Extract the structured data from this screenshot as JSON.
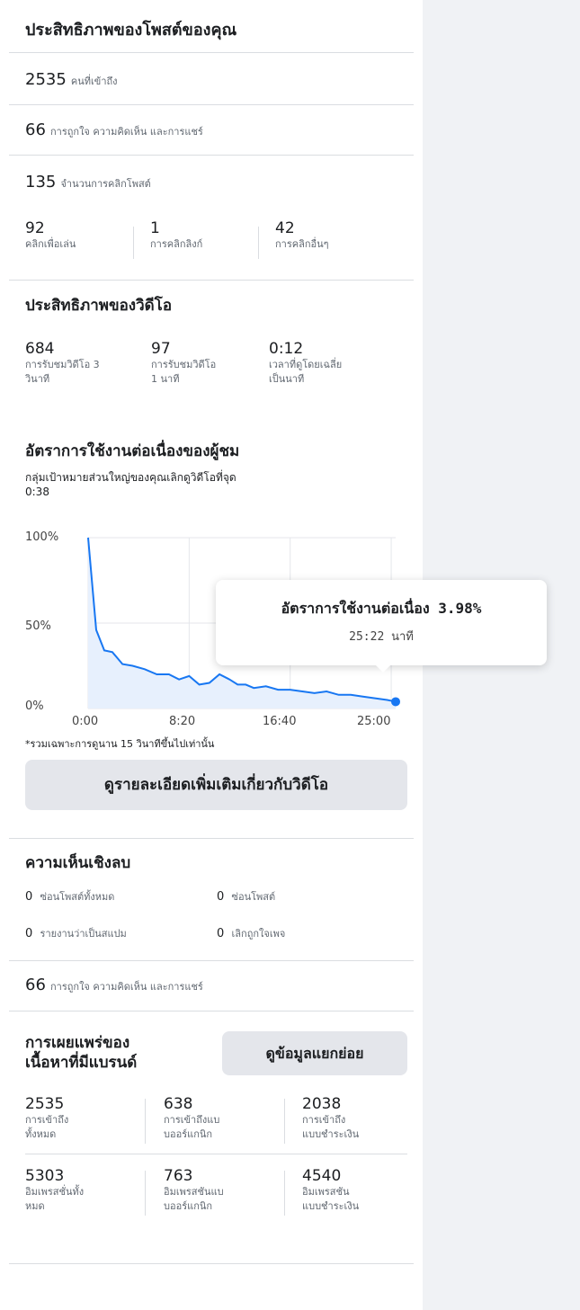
{
  "post_performance": {
    "title": "ประสิทธิภาพของโพสต์ของคุณ",
    "reach": {
      "value": "2535",
      "label": "คนที่เข้าถึง"
    },
    "engagement": {
      "value": "66",
      "label": "การถูกใจ ความคิดเห็น และการแชร์"
    },
    "clicks": {
      "value": "135",
      "label": "จำนวนการคลิกโพสต์"
    },
    "click_breakdown": [
      {
        "value": "92",
        "label": "คลิกเพื่อเล่น"
      },
      {
        "value": "1",
        "label": "การคลิกลิงก์"
      },
      {
        "value": "42",
        "label": "การคลิกอื่นๆ"
      }
    ]
  },
  "video_performance": {
    "title": "ประสิทธิภาพของวิดีโอ",
    "stats": [
      {
        "value": "684",
        "label1": "การรับชมวิดีโอ 3",
        "label2": "วินาที"
      },
      {
        "value": "97",
        "label1": "การรับชมวิดีโอ",
        "label2": "1 นาที"
      },
      {
        "value": "0:12",
        "label1": "เวลาที่ดูโดยเฉลี่ย",
        "label2": "เป็นนาที"
      }
    ],
    "retention_title": "อัตราการใช้งานต่อเนื่องของผู้ชม",
    "retention_subtitle1": "กลุ่มเป้าหมายส่วนใหญ่ของคุณเลิกดูวิดีโอที่จุด",
    "retention_subtitle2": "0:38",
    "footnote": "*รวมเฉพาะการดูนาน 15 วินาทีขึ้นไปเท่านั้น",
    "more_button": "ดูรายละเอียดเพิ่มเติมเกี่ยวกับวิดีโอ",
    "tooltip": {
      "title": "อัตราการใช้งานต่อเนื่อง 3.98%",
      "time": "25:22 นาที"
    }
  },
  "chart_data": {
    "type": "area",
    "x_ticks": [
      "0:00",
      "8:20",
      "16:40",
      "25:00"
    ],
    "y_ticks": [
      "100%",
      "50%",
      "0%"
    ],
    "ylim": [
      0,
      100
    ],
    "xlim_seconds": [
      0,
      1522
    ],
    "grid": true,
    "x_seconds": [
      0,
      40,
      80,
      120,
      170,
      220,
      280,
      340,
      400,
      450,
      500,
      550,
      600,
      650,
      700,
      740,
      780,
      820,
      880,
      940,
      1000,
      1060,
      1120,
      1180,
      1240,
      1300,
      1360,
      1420,
      1480,
      1522
    ],
    "values": [
      100,
      46,
      34,
      33,
      26,
      25,
      23,
      20,
      20,
      17,
      19,
      14,
      15,
      20,
      17,
      14,
      14,
      12,
      13,
      11,
      11,
      10,
      9,
      10,
      8,
      8,
      7,
      6,
      5,
      3.98
    ],
    "highlight_point": {
      "x_seconds": 1522,
      "value": 3.98
    },
    "line_color": "#1877f2",
    "fill_color": "#e7f0fd"
  },
  "negative_feedback": {
    "title": "ความเห็นเชิงลบ",
    "items": [
      {
        "value": "0",
        "label": "ซ่อนโพสต์ทั้งหมด"
      },
      {
        "value": "0",
        "label": "ซ่อนโพสต์"
      },
      {
        "value": "0",
        "label": "รายงานว่าเป็นสแปม"
      },
      {
        "value": "0",
        "label": "เลิกถูกใจเพจ"
      }
    ],
    "engagement": {
      "value": "66",
      "label": "การถูกใจ ความคิดเห็น และการแชร์"
    }
  },
  "branded_content": {
    "title1": "การเผยแพร่ของ",
    "title2": "เนื้อหาที่มีแบรนด์",
    "breakdown_button": "ดูข้อมูลแยกย่อย",
    "reach_stats": [
      {
        "value": "2535",
        "label1": "การเข้าถึง",
        "label2": "ทั้งหมด"
      },
      {
        "value": "638",
        "label1": "การเข้าถึงแบ",
        "label2": "บออร์แกนิก"
      },
      {
        "value": "2038",
        "label1": "การเข้าถึง",
        "label2": "แบบชำระเงิน"
      }
    ],
    "impression_stats": [
      {
        "value": "5303",
        "label1": "อิมเพรสชั่นทั้ง",
        "label2": "หมด"
      },
      {
        "value": "763",
        "label1": "อิมเพรสชันแบ",
        "label2": "บออร์แกนิก"
      },
      {
        "value": "4540",
        "label1": "อิมเพรสชัน",
        "label2": "แบบชำระเงิน"
      }
    ]
  }
}
